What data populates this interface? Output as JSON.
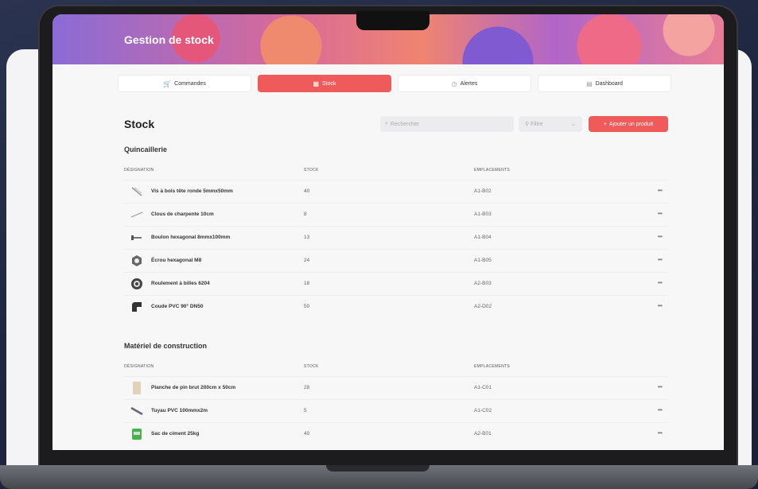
{
  "app": {
    "title": "Gestion de stock"
  },
  "tabs": [
    {
      "label": "Commandes",
      "icon": "cart-icon",
      "active": false
    },
    {
      "label": "Stock",
      "icon": "grid-icon",
      "active": true
    },
    {
      "label": "Alertes",
      "icon": "alert-icon",
      "active": false
    },
    {
      "label": "Dashboard",
      "icon": "dashboard-icon",
      "active": false
    }
  ],
  "page": {
    "title": "Stock",
    "search_placeholder": "Rechercher",
    "filter_label": "Filtre",
    "add_button": "Ajouter un produit"
  },
  "columns": {
    "designation": "DÉSIGNATION",
    "stock": "STOCK",
    "locations": "EMPLACEMENTS"
  },
  "sections": [
    {
      "title": "Quincaillerie",
      "rows": [
        {
          "name": "Vis à bois tête ronde 5mmx50mm",
          "stock": "40",
          "location": "A1-B02",
          "icon": "screw-icon"
        },
        {
          "name": "Clous de charpente 10cm",
          "stock": "8",
          "location": "A1-B03",
          "icon": "nail-icon"
        },
        {
          "name": "Boulon hexagonal 8mmx100mm",
          "stock": "13",
          "location": "A1-B04",
          "icon": "bolt-icon"
        },
        {
          "name": "Écrou hexagonal M8",
          "stock": "24",
          "location": "A1-B05",
          "icon": "nut-icon"
        },
        {
          "name": "Roulement à billes 6204",
          "stock": "18",
          "location": "A2-B03",
          "icon": "bearing-icon"
        },
        {
          "name": "Coude PVC 90° DN50",
          "stock": "50",
          "location": "A2-D02",
          "icon": "pvc-elbow-icon"
        }
      ]
    },
    {
      "title": "Matériel de construction",
      "rows": [
        {
          "name": "Planche de pin brut 200cm x 50cm",
          "stock": "28",
          "location": "A1-C01",
          "icon": "plank-icon"
        },
        {
          "name": "Tuyau PVC 100mmx2m",
          "stock": "5",
          "location": "A1-C02",
          "icon": "pipe-icon"
        },
        {
          "name": "Sac de ciment 25kg",
          "stock": "40",
          "location": "A2-B01",
          "icon": "cement-bag-icon"
        }
      ]
    }
  ],
  "colors": {
    "accent": "#ef5b5b",
    "background": "#1f2740"
  }
}
